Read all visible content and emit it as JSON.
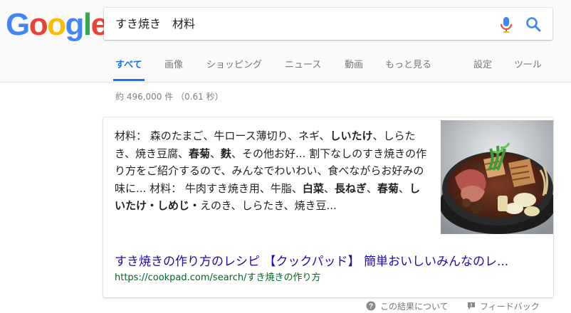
{
  "logo": {
    "letters": [
      {
        "ch": "G",
        "color": "#4285F4"
      },
      {
        "ch": "o",
        "color": "#EA4335"
      },
      {
        "ch": "o",
        "color": "#FBBC05"
      },
      {
        "ch": "g",
        "color": "#4285F4"
      },
      {
        "ch": "l",
        "color": "#34A853"
      },
      {
        "ch": "e",
        "color": "#EA4335"
      }
    ]
  },
  "search": {
    "query": "すき焼き　材料"
  },
  "tabs": [
    {
      "label": "すべて",
      "active": true
    },
    {
      "label": "画像"
    },
    {
      "label": "ショッピング"
    },
    {
      "label": "ニュース"
    },
    {
      "label": "動画"
    },
    {
      "label": "もっと見る"
    },
    {
      "label": "設定"
    },
    {
      "label": "ツール"
    }
  ],
  "stats": "約 496,000 件 （0.61 秒）",
  "result": {
    "snippet": [
      {
        "t": "材料： 森のたまご、牛ロース薄切り、ネギ、"
      },
      {
        "t": "しいたけ",
        "b": true
      },
      {
        "t": "、しらたき、焼き豆腐、"
      },
      {
        "t": "春菊",
        "b": true
      },
      {
        "t": "、"
      },
      {
        "t": "麩",
        "b": true
      },
      {
        "t": "、その他お好... 割下なしのすき焼きの作り方をご紹介するので、みんなでわいわい、食べながらお好みの味に... 材料： 牛肉すき焼き用、牛脂、"
      },
      {
        "t": "白菜",
        "b": true
      },
      {
        "t": "、"
      },
      {
        "t": "長ねぎ",
        "b": true
      },
      {
        "t": "、"
      },
      {
        "t": "春菊",
        "b": true
      },
      {
        "t": "、"
      },
      {
        "t": "しいたけ・しめじ・",
        "b": true
      },
      {
        "t": "えのき、しらたき、焼き豆..."
      }
    ],
    "title": "すき焼きの作り方のレシピ 【クックパッド】 簡単おいしいみんなのレ...",
    "url": "https://cookpad.com/search/すき焼きの作り方"
  },
  "footer": {
    "about": "この結果について",
    "feedback": "フィードバック"
  },
  "colors": {
    "accent": "#1a73e8",
    "link": "#1a0dab",
    "url": "#006621"
  },
  "icons": {
    "mic": "microphone-icon",
    "search": "search-icon",
    "help": "question-circle-icon",
    "feedback": "feedback-flag-icon"
  }
}
